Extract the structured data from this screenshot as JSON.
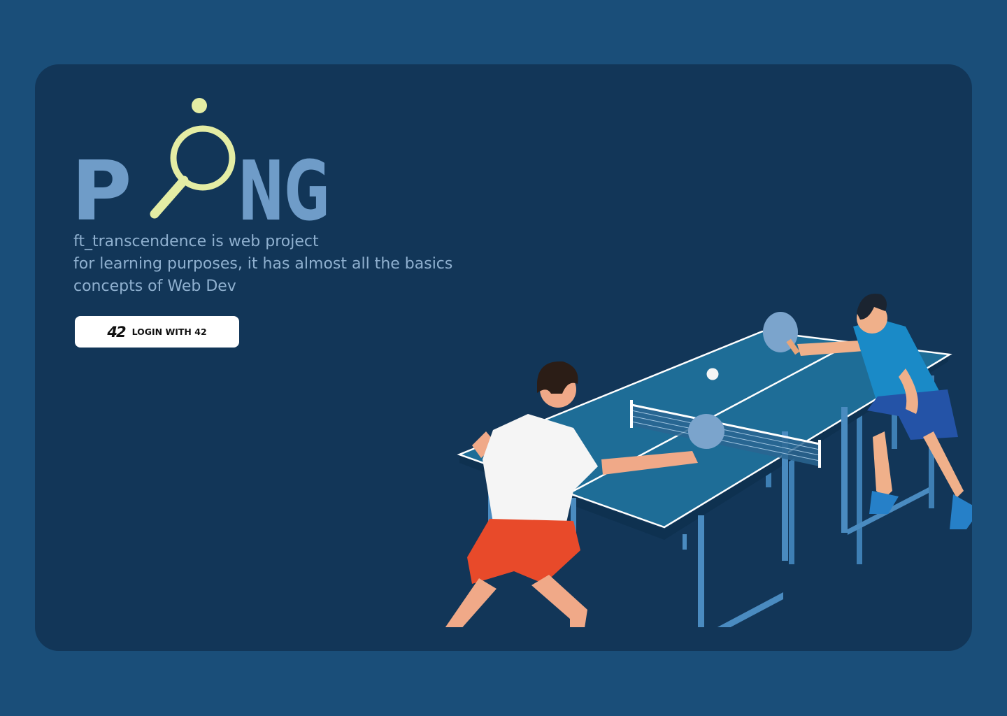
{
  "brand": {
    "logo_text": "PONG",
    "letters": [
      "P",
      "N",
      "G"
    ]
  },
  "description": {
    "lines": [
      "ft_transcendence is web project",
      "for learning purposes, it has almost all the basics",
      "concepts of Web Dev"
    ]
  },
  "login_button": {
    "icon_text": "42",
    "label": "LOGIN WITH 42"
  },
  "colors": {
    "page_background": "#1a4e79",
    "card_background": "#123658",
    "logo_letters": "#6f9cc8",
    "logo_racket": "#e4eda4",
    "description_text": "#8fb0cf",
    "table_surface": "#1e6d97",
    "button_background": "#ffffff"
  },
  "icons": {
    "logo_o": "ping-pong-racket-with-ball",
    "button": "42-school-logo"
  }
}
